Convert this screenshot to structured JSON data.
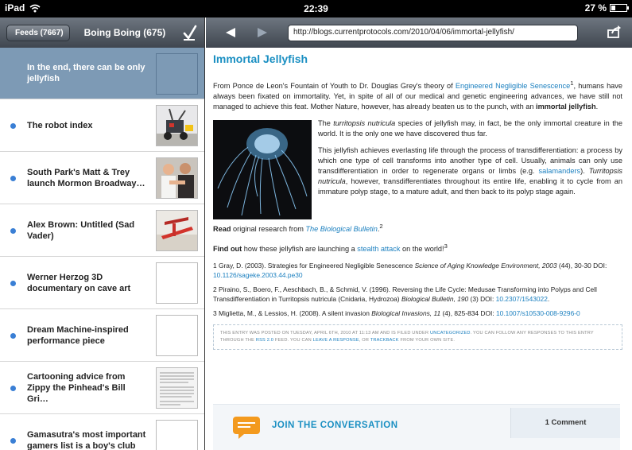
{
  "status_bar": {
    "device": "iPad",
    "time": "22:39",
    "battery": "27 %",
    "battery_level": 0.27
  },
  "sidebar": {
    "back_label": "Feeds (7667)",
    "title": "Boing Boing (675)",
    "items": [
      {
        "title": "In the end, there can be only jellyfish",
        "unread": false,
        "selected": true,
        "thumb": "empty"
      },
      {
        "title": "The robot index",
        "unread": true,
        "selected": false,
        "thumb": "robot-photo"
      },
      {
        "title": "South Park's Matt & Trey launch Mormon Broadway…",
        "unread": true,
        "selected": false,
        "thumb": "people-photo"
      },
      {
        "title": "Alex Brown: Untitled (Sad Vader)",
        "unread": true,
        "selected": false,
        "thumb": "sculpture-photo"
      },
      {
        "title": "Werner Herzog 3D documentary on cave art",
        "unread": true,
        "selected": false,
        "thumb": "empty"
      },
      {
        "title": "Dream Machine-inspired performance piece",
        "unread": true,
        "selected": false,
        "thumb": "empty"
      },
      {
        "title": "Cartooning advice from Zippy the Pinhead's Bill Gri…",
        "unread": true,
        "selected": false,
        "thumb": "document-photo"
      },
      {
        "title": "Gamasutra's most important gamers list is a boy's club",
        "unread": true,
        "selected": false,
        "thumb": "empty"
      }
    ]
  },
  "browser": {
    "url": "http://blogs.currentprotocols.com/2010/04/06/immortal-jellyfish/"
  },
  "article": {
    "title": "Immortal Jellyfish",
    "p1": {
      "a": "From Ponce de Leon's Fountain of Youth to Dr. Douglas Grey's theory of ",
      "link": "Engineered Negligible Senescence",
      "sup": "1",
      "b": ", humans have always been fixated on immortality. Yet, in spite of all of our medical and genetic engineering advances, we have still not managed to achieve this feat. Mother Nature, however, has already beaten us to the punch, with an ",
      "bold": "immortal jellyfish",
      "c": "."
    },
    "p2": {
      "a": "The ",
      "em": "turritopsis nutricula",
      "b": " species of jellyfish may, in fact, be the only immortal creature in the world. It is the only one we have discovered thus far."
    },
    "p3": {
      "a": "This jellyfish achieves everlasting life through the process of transdifferentiation: a process by which one type of cell transforms into another type of cell. Usually, animals can only use transdifferentiation in order to regenerate organs or limbs (e.g. ",
      "link": "salamanders",
      "b": "). ",
      "em": "Turritopsis nutricula",
      "c": ", however, transdifferentiates throughout its entire life, enabling it to cycle from an immature polyp stage, to a mature adult, and then back to its polyp stage again."
    },
    "read": {
      "bold": "Read",
      "a": " original research from ",
      "link": "The Biological Bulletin",
      "b": ".",
      "sup": "2"
    },
    "findout": {
      "bold": "Find out",
      "a": " how these jellyfish are launching a ",
      "link": "stealth attack",
      "b": " on the world!",
      "sup": "3"
    },
    "refs": [
      {
        "a": "1 Gray, D. (2003). Strategies for Engineered Negligible Senescence ",
        "em": "Science of Aging Knowledge Environment, 2003",
        "b": " (44), 30-30 DOI: ",
        "link": "10.1126/sageke.2003.44.pe30",
        "c": ""
      },
      {
        "a": "2 Piraino, S., Boero, F., Aeschbach, B., & Schmid, V. (1996). Reversing the Life Cycle: Medusae Transforming into Polyps and Cell Transdifferentiation in Turritopsis nutricula (Cnidaria, Hydrozoa) ",
        "em": "Biological Bulletin, 190",
        "b": " (3) DOI: ",
        "link": "10.2307/1543022",
        "c": "."
      },
      {
        "a": "3 Miglietta, M., & Lessios, H. (2008). A silent invasion ",
        "em": "Biological Invasions, 11",
        "b": " (4), 825-834 DOI: ",
        "link": "10.1007/s10530-008-9296-0",
        "c": ""
      }
    ],
    "meta": {
      "a": "THIS ENTRY WAS POSTED ON TUESDAY, APRIL 6TH, 2010 AT 11:13 AM AND IS FILED UNDER ",
      "link1": "UNCATEGORIZED",
      "b": ". YOU CAN FOLLOW ANY RESPONSES TO THIS ENTRY THROUGH THE ",
      "link2": "RSS 2.0",
      "c": " FEED. YOU CAN ",
      "link3": "LEAVE A RESPONSE",
      "d": ", OR ",
      "link4": "TRACKBACK",
      "e": " FROM YOUR OWN SITE."
    }
  },
  "conversation": {
    "title": "JOIN THE CONVERSATION",
    "comments": "1 Comment"
  },
  "colors": {
    "accent": "#1a8fc2",
    "unread_dot": "#3a7fd5",
    "selected_row": "#7d9ab5",
    "toolbar": "#4f5660"
  }
}
